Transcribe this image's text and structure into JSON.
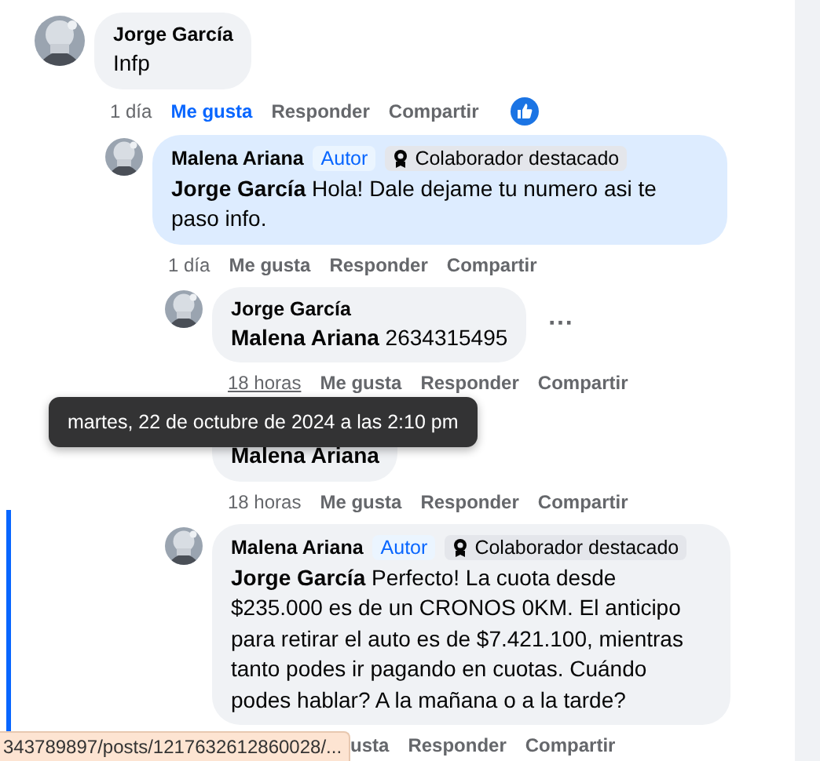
{
  "comments": [
    {
      "author": "Jorge García",
      "text": "Infp",
      "highlighted": false,
      "reaction": true,
      "actions": [
        {
          "kind": "time",
          "label": "1 día",
          "underlined": false
        },
        {
          "kind": "like",
          "label": "Me gusta",
          "selected": true
        },
        {
          "kind": "reply",
          "label": "Responder"
        },
        {
          "kind": "share",
          "label": "Compartir"
        }
      ],
      "children": [
        {
          "author": "Malena Ariana",
          "badges": [
            {
              "kind": "author",
              "label": "Autor"
            },
            {
              "kind": "top",
              "label": "Colaborador destacado"
            }
          ],
          "text": "**Jorge García** Hola! Dale dejame tu numero asi te paso info.",
          "highlighted": true,
          "actions": [
            {
              "kind": "time",
              "label": "1 día",
              "underlined": false
            },
            {
              "kind": "like",
              "label": "Me gusta",
              "selected": false
            },
            {
              "kind": "reply",
              "label": "Responder"
            },
            {
              "kind": "share",
              "label": "Compartir"
            }
          ],
          "children": [
            {
              "author": "Jorge García",
              "text": "**Malena Ariana** 2634315495",
              "highlighted": false,
              "more": "···",
              "actions": [
                {
                  "kind": "time",
                  "label": "18 horas",
                  "underlined": true
                },
                {
                  "kind": "like",
                  "label": "Me gusta",
                  "selected": false
                },
                {
                  "kind": "reply",
                  "label": "Responder"
                },
                {
                  "kind": "share",
                  "label": "Compartir"
                }
              ]
            },
            {
              "text": "**Malena Ariana**",
              "highlighted": false,
              "actions": [
                {
                  "kind": "time",
                  "label": "18 horas",
                  "underlined": false
                },
                {
                  "kind": "like",
                  "label": "Me gusta",
                  "selected": false
                },
                {
                  "kind": "reply",
                  "label": "Responder"
                },
                {
                  "kind": "share",
                  "label": "Compartir"
                }
              ]
            },
            {
              "author": "Malena Ariana",
              "badges": [
                {
                  "kind": "author",
                  "label": "Autor"
                },
                {
                  "kind": "top",
                  "label": "Colaborador destacado"
                }
              ],
              "text": "**Jorge García** Perfecto! La cuota desde $235.000 es de un CRONOS 0KM. El anticipo para retirar el auto es de $7.421.100, mientras tanto podes ir pagando en cuotas. Cuándo podes hablar? A la mañana o a la tarde?",
              "highlighted": false,
              "actions": [
                {
                  "kind": "like",
                  "label": "usta",
                  "selected": false
                },
                {
                  "kind": "reply",
                  "label": "Responder"
                },
                {
                  "kind": "share",
                  "label": "Compartir"
                }
              ]
            }
          ]
        }
      ]
    }
  ],
  "tooltip": "martes, 22 de octubre de 2024 a las 2:10 pm",
  "status_url": "343789897/posts/1217632612860028/..."
}
